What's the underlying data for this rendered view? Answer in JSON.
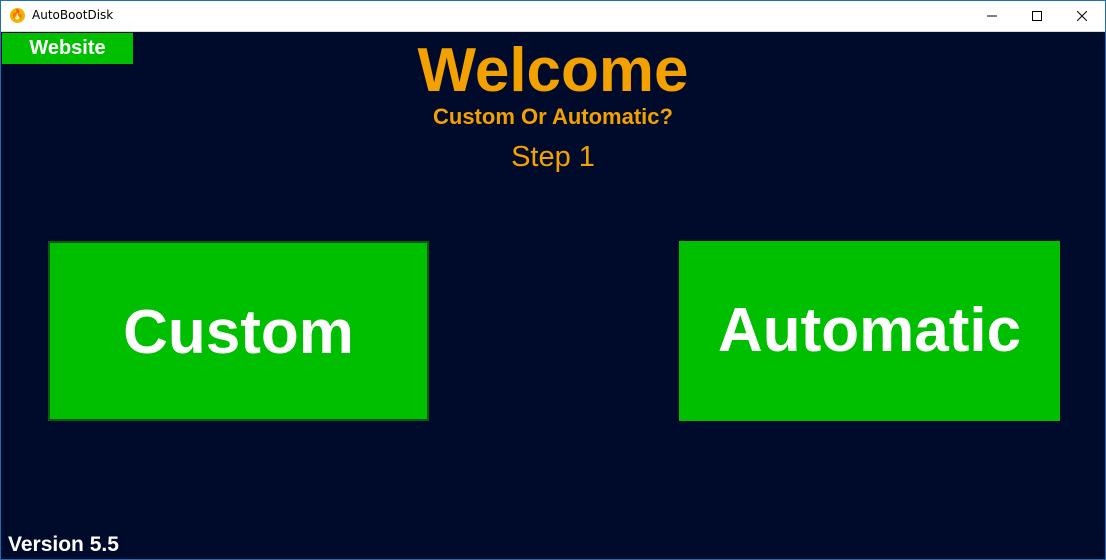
{
  "window": {
    "title": "AutoBootDisk",
    "icon": "flame-icon"
  },
  "header": {
    "website_label": "Website",
    "welcome": "Welcome",
    "subtitle": "Custom Or Automatic?",
    "step": "Step 1"
  },
  "main": {
    "custom_label": "Custom",
    "automatic_label": "Automatic"
  },
  "footer": {
    "version": "Version 5.5"
  },
  "colors": {
    "background": "#000a2a",
    "accent_green": "#00bf00",
    "heading_orange": "#f3a100",
    "button_text": "#ffffff"
  }
}
